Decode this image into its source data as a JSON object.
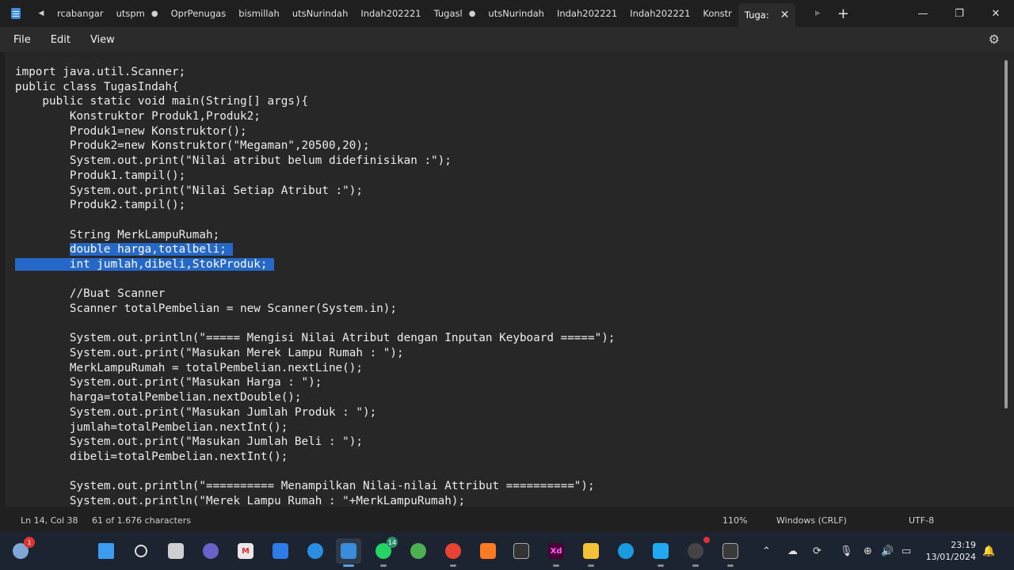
{
  "titlebar": {
    "tabs": [
      {
        "label": "rcabangar"
      },
      {
        "label": "utspm",
        "unsaved": "●"
      },
      {
        "label": "OprPenugas"
      },
      {
        "label": "bismillah"
      },
      {
        "label": "utsNurindah"
      },
      {
        "label": "Indah202221"
      },
      {
        "label": "Tugasl",
        "unsaved": "●"
      },
      {
        "label": "utsNurindah"
      },
      {
        "label": "Indah202221"
      },
      {
        "label": "Indah202221"
      },
      {
        "label": "Konstr"
      }
    ],
    "active_tab": "Tuga:",
    "close_glyph": "✕",
    "new_tab_glyph": "+"
  },
  "menu": {
    "file": "File",
    "edit": "Edit",
    "view": "View"
  },
  "editor": {
    "lines": [
      "import java.util.Scanner;",
      "public class TugasIndah{",
      "    public static void main(String[] args){",
      "        Konstruktor Produk1,Produk2;",
      "        Produk1=new Konstruktor();",
      "        Produk2=new Konstruktor(\"Megaman\",20500,20);",
      "        System.out.print(\"Nilai atribut belum didefinisikan :\");",
      "        Produk1.tampil();",
      "        System.out.print(\"Nilai Setiap Atribut :\");",
      "        Produk2.tampil();",
      "",
      "        String MerkLampuRumah;",
      "        double harga,totalbeli;",
      "        int jumlah,dibeli,StokProduk;",
      "",
      "        //Buat Scanner",
      "        Scanner totalPembelian = new Scanner(System.in);",
      "",
      "        System.out.println(\"===== Mengisi Nilai Atribut dengan Inputan Keyboard =====\");",
      "        System.out.print(\"Masukan Merek Lampu Rumah : \");",
      "        MerkLampuRumah = totalPembelian.nextLine();",
      "        System.out.print(\"Masukan Harga : \");",
      "        harga=totalPembelian.nextDouble();",
      "        System.out.print(\"Masukan Jumlah Produk : \");",
      "        jumlah=totalPembelian.nextInt();",
      "        System.out.print(\"Masukan Jumlah Beli : \");",
      "        dibeli=totalPembelian.nextInt();",
      "",
      "        System.out.println(\"========== Menampilkan Nilai-nilai Attribut ==========\");",
      "        System.out.println(\"Merek Lampu Rumah : \"+MerkLampuRumah);"
    ],
    "selected_lines": [
      12,
      13
    ]
  },
  "status": {
    "position": "Ln 14, Col 38",
    "chars": "61 of 1.676 characters",
    "zoom": "110%",
    "line_ending": "Windows (CRLF)",
    "encoding": "UTF-8"
  },
  "taskbar": {
    "weather_badge": "1",
    "whatsapp_badge": "14",
    "xd_label": "Xd",
    "clock_time": "23:19",
    "clock_date": "13/01/2024"
  }
}
